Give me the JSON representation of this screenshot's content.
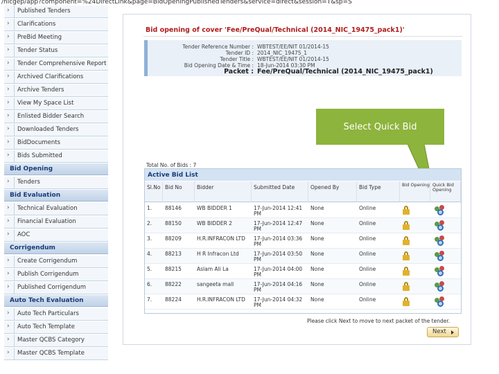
{
  "url_text": "/nicgep/app?component=%24DirectLink&page=BidOpeningPublishedTenders&service=direct&session=T&sp=S",
  "sidebar": {
    "items_top": [
      "Published Tenders",
      "Clarifications",
      "PreBid Meeting",
      "Tender Status",
      "Tender Comprehensive Report",
      "Archived Clarifications",
      "Archive Tenders",
      "View My Space List",
      "Enlisted Bidder Search",
      "Downloaded Tenders",
      "BidDocuments",
      "Bids Submitted"
    ],
    "section_bid_opening": "Bid Opening",
    "items_bid_opening": [
      "Tenders"
    ],
    "section_bid_evaluation": "Bid Evaluation",
    "items_bid_evaluation": [
      "Technical Evaluation",
      "Financial Evaluation",
      "AOC"
    ],
    "section_corrigendum": "Corrigendum",
    "items_corrigendum": [
      "Create Corrigendum",
      "Publish Corrigendum",
      "Published Corrigendum"
    ],
    "section_auto_tech": "Auto Tech Evaluation",
    "items_auto_tech": [
      "Auto Tech Particulars",
      "Auto Tech Template",
      "Master QCBS Category",
      "Master QCBS Template"
    ]
  },
  "main": {
    "title": "Bid opening of cover 'Fee/PreQual/Technical (2014_NIC_19475_pack1)'",
    "info": {
      "tender_ref_label": "Tender Reference Number :",
      "tender_ref_value": "WBTEST/EE/NIT 01/2014-15",
      "tender_id_label": "Tender ID :",
      "tender_id_value": "2014_NIC_19475_1",
      "tender_title_label": "Tender Title :",
      "tender_title_value": "WBTEST/EE/NIT 01/2014-15",
      "opening_date_label": "Bid Opening Date & Time :",
      "opening_date_value": "18-Jun-2014 03:30 PM",
      "packet_label": "Packet :",
      "packet_value": "Fee/PreQual/Technical (2014_NIC_19475_pack1)"
    },
    "callout": "Select Quick Bid",
    "total_bids": "Total No. of Bids : 7",
    "active_bid_list": "Active Bid List",
    "columns": [
      "Sl.No",
      "Bid No",
      "Bidder",
      "Submitted Date",
      "Opened By",
      "Bid Type",
      "Bid Opening",
      "Quick Bid Opening"
    ],
    "rows": [
      {
        "sl": "1.",
        "bid_no": "88146",
        "bidder": "WB BIDDER 1",
        "date": "17-Jun-2014 12:41 PM",
        "opened_by": "None",
        "type": "Online"
      },
      {
        "sl": "2.",
        "bid_no": "88150",
        "bidder": "WB BIDDER 2",
        "date": "17-Jun-2014 12:47 PM",
        "opened_by": "None",
        "type": "Online"
      },
      {
        "sl": "3.",
        "bid_no": "88209",
        "bidder": "H.R.INFRACON LTD",
        "date": "17-Jun-2014 03:36 PM",
        "opened_by": "None",
        "type": "Online"
      },
      {
        "sl": "4.",
        "bid_no": "88213",
        "bidder": "H R Infracon Ltd",
        "date": "17-Jun-2014 03:50 PM",
        "opened_by": "None",
        "type": "Online"
      },
      {
        "sl": "5.",
        "bid_no": "88215",
        "bidder": "Aslam Ali La",
        "date": "17-Jun-2014 04:00 PM",
        "opened_by": "None",
        "type": "Online"
      },
      {
        "sl": "6.",
        "bid_no": "88222",
        "bidder": "sangeeta mall",
        "date": "17-Jun-2014 04:16 PM",
        "opened_by": "None",
        "type": "Online"
      },
      {
        "sl": "7.",
        "bid_no": "88224",
        "bidder": "H.R.INFRACON LTD",
        "date": "17-Jun-2014 04:32 PM",
        "opened_by": "None",
        "type": "Online"
      }
    ],
    "note": "Please click Next to move to next packet of the tender.",
    "next_label": "Next"
  },
  "colors": {
    "accent_title": "#b01c1c",
    "callout_bg": "#8db43c",
    "section_head_text": "#1a3c78"
  },
  "icons": {
    "bid_opening": "lock-icon",
    "quick_bid_opening": "quick-bid-open-icon"
  }
}
